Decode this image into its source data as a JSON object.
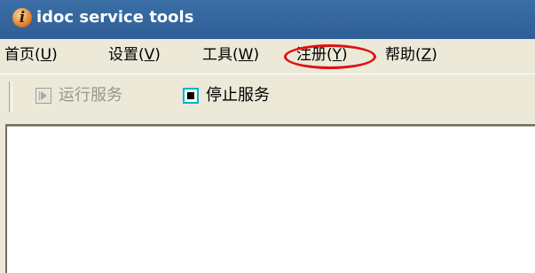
{
  "window": {
    "title": "idoc service tools",
    "icon": "i"
  },
  "menu": {
    "items": [
      {
        "label": "首页(",
        "key": "U",
        "end": ")"
      },
      {
        "label": "设置(",
        "key": "V",
        "end": ")"
      },
      {
        "label": "工具(",
        "key": "W",
        "end": ")"
      },
      {
        "label": "注册(",
        "key": "Y",
        "end": ")"
      },
      {
        "label": "帮助(",
        "key": "Z",
        "end": ")"
      }
    ],
    "highlighted_index": 3
  },
  "toolbar": {
    "run_label": "运行服务",
    "run_enabled": false,
    "stop_label": "停止服务",
    "stop_enabled": true
  },
  "colors": {
    "titlebar": "#3a6ea5",
    "highlight_ring": "#e01010",
    "stop_icon_border": "#00b4c8"
  }
}
